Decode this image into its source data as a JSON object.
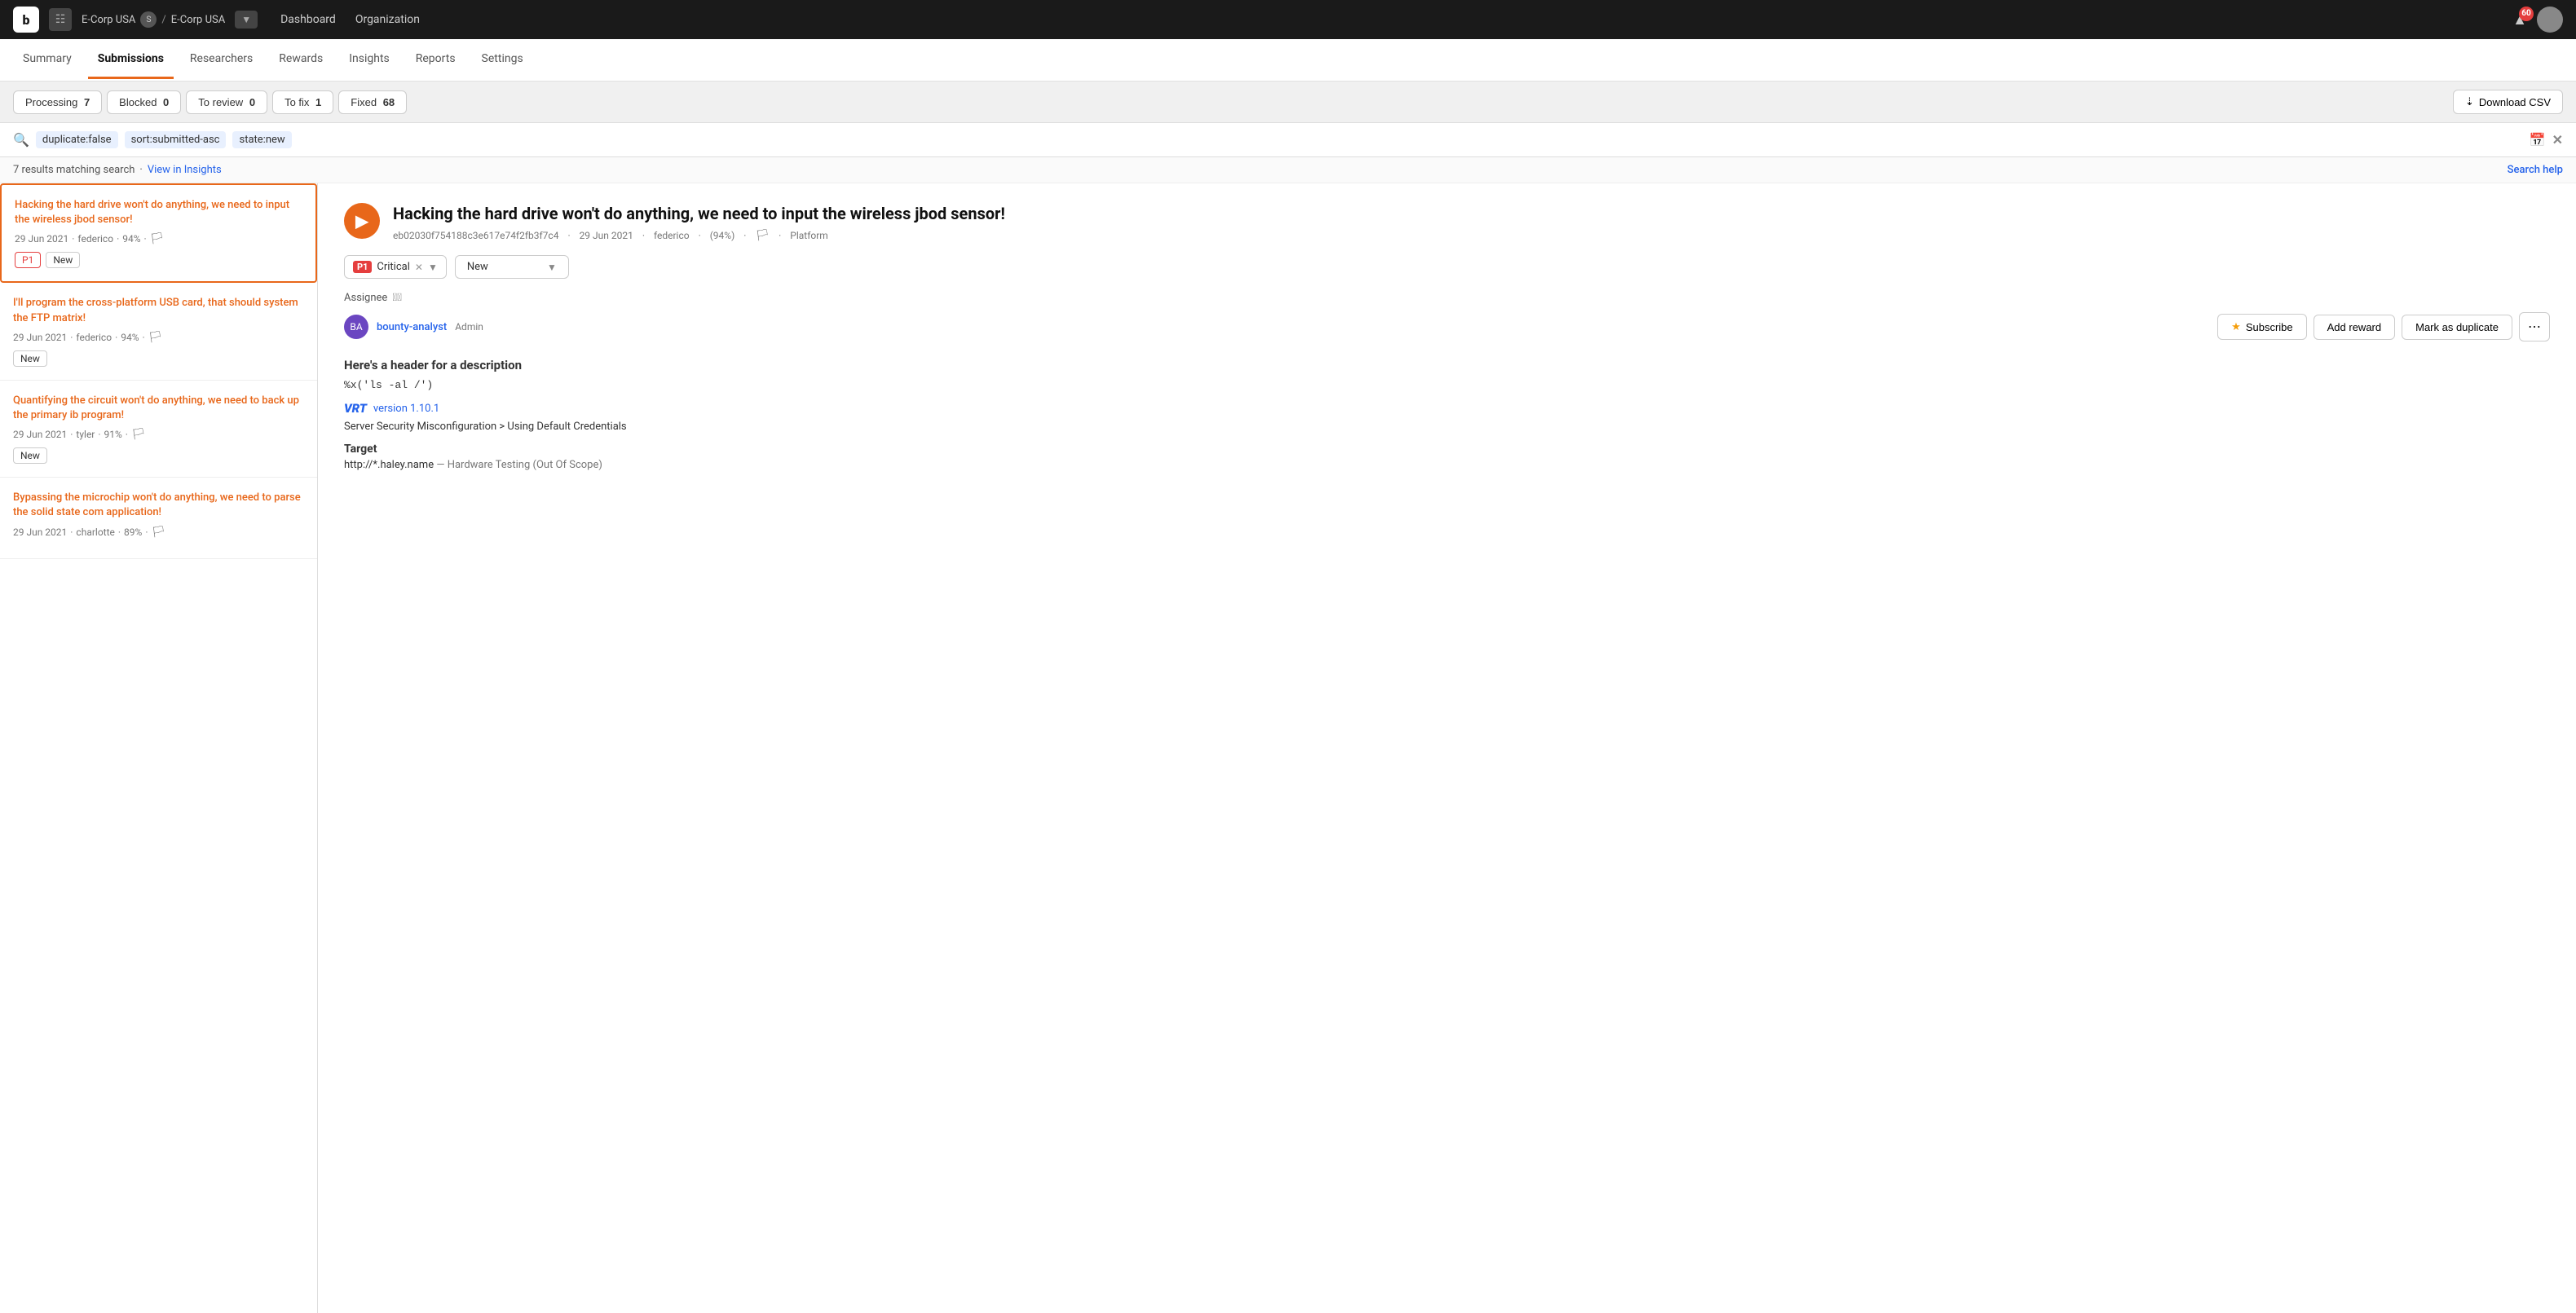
{
  "topnav": {
    "logo": "b",
    "org_path": "E-Corp USA / E-Corp USA",
    "org_1": "E-Corp USA",
    "org_separator": "/",
    "org_2": "E-Corp USA",
    "nav_items": [
      "Dashboard",
      "Organization"
    ],
    "notif_count": "60"
  },
  "main_tabs": {
    "items": [
      {
        "label": "Summary",
        "active": false
      },
      {
        "label": "Submissions",
        "active": true
      },
      {
        "label": "Researchers",
        "active": false
      },
      {
        "label": "Rewards",
        "active": false
      },
      {
        "label": "Insights",
        "active": false
      },
      {
        "label": "Reports",
        "active": false
      },
      {
        "label": "Settings",
        "active": false
      }
    ]
  },
  "status_bar": {
    "pills": [
      {
        "label": "Processing",
        "count": "7",
        "active": false
      },
      {
        "label": "Blocked",
        "count": "0",
        "active": false
      },
      {
        "label": "To review",
        "count": "0",
        "active": false
      },
      {
        "label": "To fix",
        "count": "1",
        "active": false
      },
      {
        "label": "Fixed",
        "count": "68",
        "active": false
      }
    ],
    "download_btn": "Download CSV"
  },
  "search": {
    "tags": [
      "duplicate:false",
      "sort:submitted-asc",
      "state:new"
    ],
    "results_count": "7 results matching search",
    "view_insights": "View in Insights",
    "search_help": "Search help"
  },
  "list_items": [
    {
      "id": 1,
      "title": "Hacking the hard drive won't do anything, we need to input the wireless jbod sensor!",
      "date": "29 Jun 2021",
      "author": "federico",
      "score": "94%",
      "tags": [
        "P1",
        "New"
      ],
      "selected": true
    },
    {
      "id": 2,
      "title": "I'll program the cross-platform USB card, that should system the FTP matrix!",
      "date": "29 Jun 2021",
      "author": "federico",
      "score": "94%",
      "tags": [
        "New"
      ],
      "selected": false
    },
    {
      "id": 3,
      "title": "Quantifying the circuit won't do anything, we need to back up the primary ib program!",
      "date": "29 Jun 2021",
      "author": "tyler",
      "score": "91%",
      "tags": [
        "New"
      ],
      "selected": false
    },
    {
      "id": 4,
      "title": "Bypassing the microchip won't do anything, we need to parse the solid state com application!",
      "date": "29 Jun 2021",
      "author": "charlotte",
      "score": "89%",
      "tags": [],
      "selected": false
    }
  ],
  "detail": {
    "title": "Hacking the hard drive won't do anything, we need to input the wireless jbod sensor!",
    "hash": "eb02030f754188c3e617e74f2fb3f7c4",
    "date": "29 Jun 2021",
    "author": "federico",
    "score": "(94%)",
    "platform": "Platform",
    "severity_label": "P1—Critical",
    "severity_p1": "P1",
    "severity_name": "Critical",
    "state": "New",
    "assignee_label": "Assignee",
    "assignee_name": "bounty-analyst",
    "assignee_role": "Admin",
    "subscribe_btn": "Subscribe",
    "add_reward_btn": "Add reward",
    "mark_duplicate_btn": "Mark as duplicate",
    "desc_header": "Here's a header for a description",
    "desc_code": "%x('ls -al /')",
    "vrt_label": "VRT",
    "vrt_version": "version 1.10.1",
    "vrt_category": "Server Security Misconfiguration > Using Default Credentials",
    "target_label": "Target",
    "target_url": "http://*.haley.name",
    "target_scope": "— Hardware Testing (Out Of Scope)"
  }
}
